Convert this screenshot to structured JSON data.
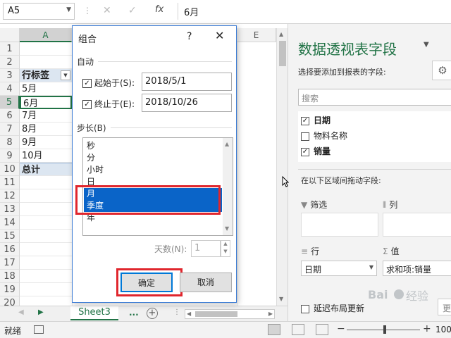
{
  "formula_bar": {
    "name_box": "A5",
    "formula": "6月"
  },
  "grid": {
    "col_a": "A",
    "col_e": "E",
    "rows": [
      {
        "num": "1",
        "value": ""
      },
      {
        "num": "2",
        "value": ""
      },
      {
        "num": "3",
        "value": "行标签"
      },
      {
        "num": "4",
        "value": "5月"
      },
      {
        "num": "5",
        "value": "6月"
      },
      {
        "num": "6",
        "value": "7月"
      },
      {
        "num": "7",
        "value": "8月"
      },
      {
        "num": "8",
        "value": "9月"
      },
      {
        "num": "9",
        "value": "10月"
      },
      {
        "num": "10",
        "value": "总计"
      },
      {
        "num": "11",
        "value": ""
      },
      {
        "num": "12",
        "value": ""
      },
      {
        "num": "13",
        "value": ""
      },
      {
        "num": "14",
        "value": ""
      },
      {
        "num": "15",
        "value": ""
      },
      {
        "num": "16",
        "value": ""
      },
      {
        "num": "17",
        "value": ""
      },
      {
        "num": "18",
        "value": ""
      },
      {
        "num": "19",
        "value": ""
      },
      {
        "num": "20",
        "value": ""
      }
    ]
  },
  "sheet_tabs": {
    "active": "Sheet3",
    "more": "...",
    "add": "+"
  },
  "status_bar": {
    "status": "就绪",
    "zoom": "100"
  },
  "pivot_pane": {
    "title": "数据透视表字段",
    "subtitle": "选择要添加到报表的字段:",
    "search_placeholder": "搜索",
    "fields": [
      {
        "label": "日期",
        "checked": true
      },
      {
        "label": "物料名称",
        "checked": false
      },
      {
        "label": "销量",
        "checked": true
      }
    ],
    "drag_hint": "在以下区域间拖动字段:",
    "areas": {
      "filter": "筛选",
      "columns": "列",
      "rows": "行",
      "values": "值"
    },
    "row_item": "日期",
    "value_item": "求和项:销量",
    "defer_label": "延迟布局更新",
    "update_button": "更"
  },
  "dialog": {
    "title": "组合",
    "help": "?",
    "close": "✕",
    "auto_section": "自动",
    "start_label": "起始于(S):",
    "start_value": "2018/5/1",
    "end_label": "终止于(E):",
    "end_value": "2018/10/26",
    "step_section": "步长(B)",
    "step_items": [
      {
        "label": "秒",
        "selected": false
      },
      {
        "label": "分",
        "selected": false
      },
      {
        "label": "小时",
        "selected": false
      },
      {
        "label": "日",
        "selected": false
      },
      {
        "label": "月",
        "selected": true
      },
      {
        "label": "季度",
        "selected": true
      },
      {
        "label": "年",
        "selected": false
      }
    ],
    "days_label": "天数(N):",
    "days_value": "1",
    "ok_label": "确定",
    "cancel_label": "取消"
  },
  "colors": {
    "excel_green": "#217346",
    "selection_blue": "#0a64c8",
    "highlight_red": "#e0262d",
    "pivot_header": "#dce6f1"
  },
  "watermark": {
    "text": "经验",
    "brand": "Baidu"
  }
}
